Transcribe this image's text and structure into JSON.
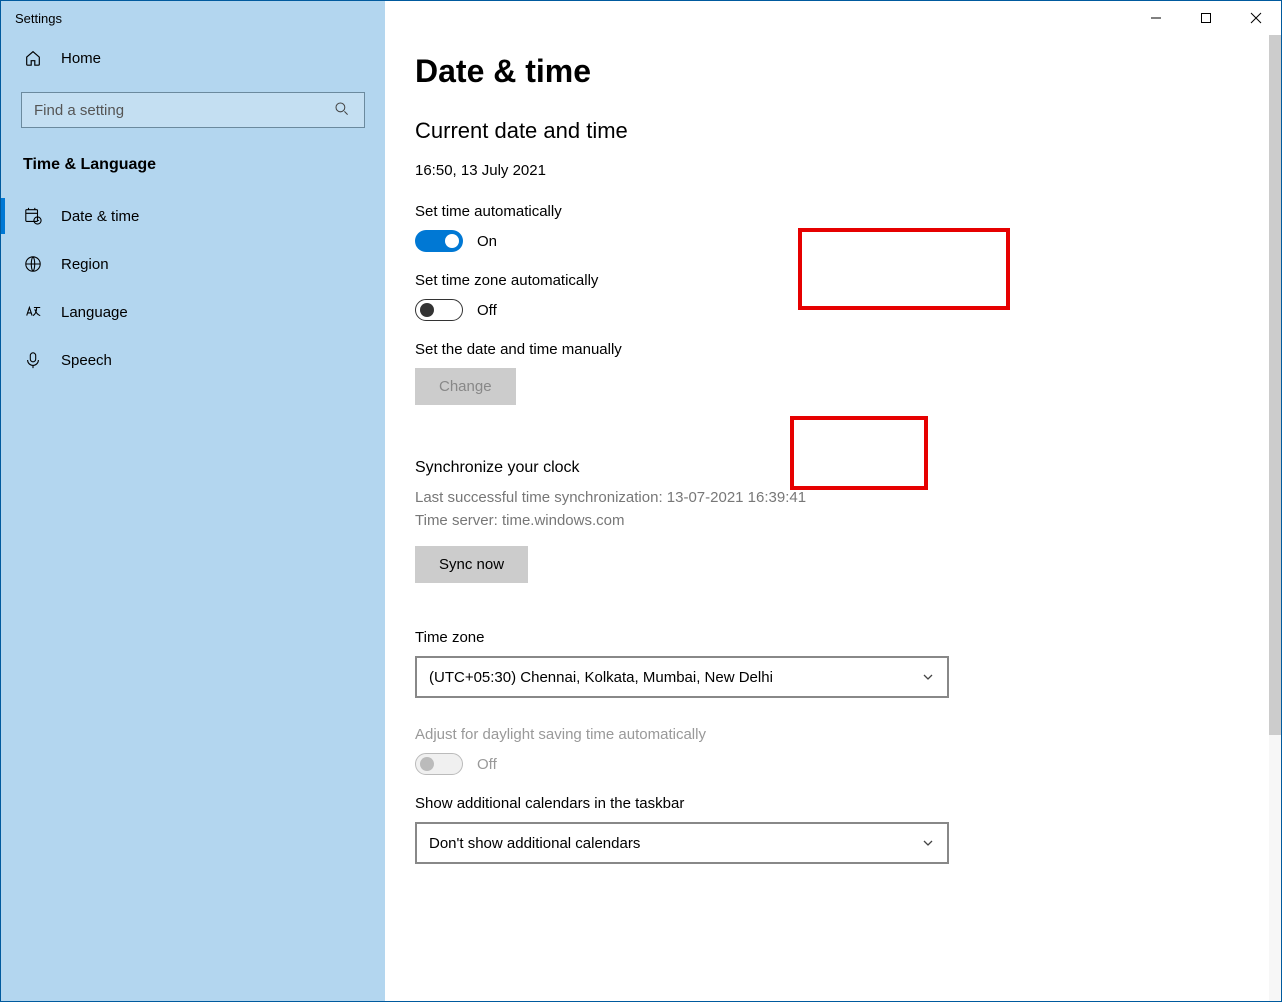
{
  "window": {
    "title": "Settings"
  },
  "sidebar": {
    "home": "Home",
    "search_placeholder": "Find a setting",
    "category": "Time & Language",
    "items": [
      {
        "label": "Date & time",
        "icon": "calendar-clock-icon"
      },
      {
        "label": "Region",
        "icon": "globe-icon"
      },
      {
        "label": "Language",
        "icon": "language-icon"
      },
      {
        "label": "Speech",
        "icon": "microphone-icon"
      }
    ]
  },
  "main": {
    "heading": "Date & time",
    "subheading": "Current date and time",
    "current": "16:50, 13 July 2021",
    "set_time_auto": {
      "label": "Set time automatically",
      "state": "On",
      "on": true
    },
    "set_tz_auto": {
      "label": "Set time zone automatically",
      "state": "Off",
      "on": false
    },
    "manual": {
      "label": "Set the date and time manually",
      "button": "Change"
    },
    "sync": {
      "heading": "Synchronize your clock",
      "last": "Last successful time synchronization: 13-07-2021 16:39:41",
      "server": "Time server: time.windows.com",
      "button": "Sync now"
    },
    "timezone": {
      "label": "Time zone",
      "value": "(UTC+05:30) Chennai, Kolkata, Mumbai, New Delhi"
    },
    "dst": {
      "label": "Adjust for daylight saving time automatically",
      "state": "Off"
    },
    "addcal": {
      "label": "Show additional calendars in the taskbar",
      "value": "Don't show additional calendars"
    }
  }
}
